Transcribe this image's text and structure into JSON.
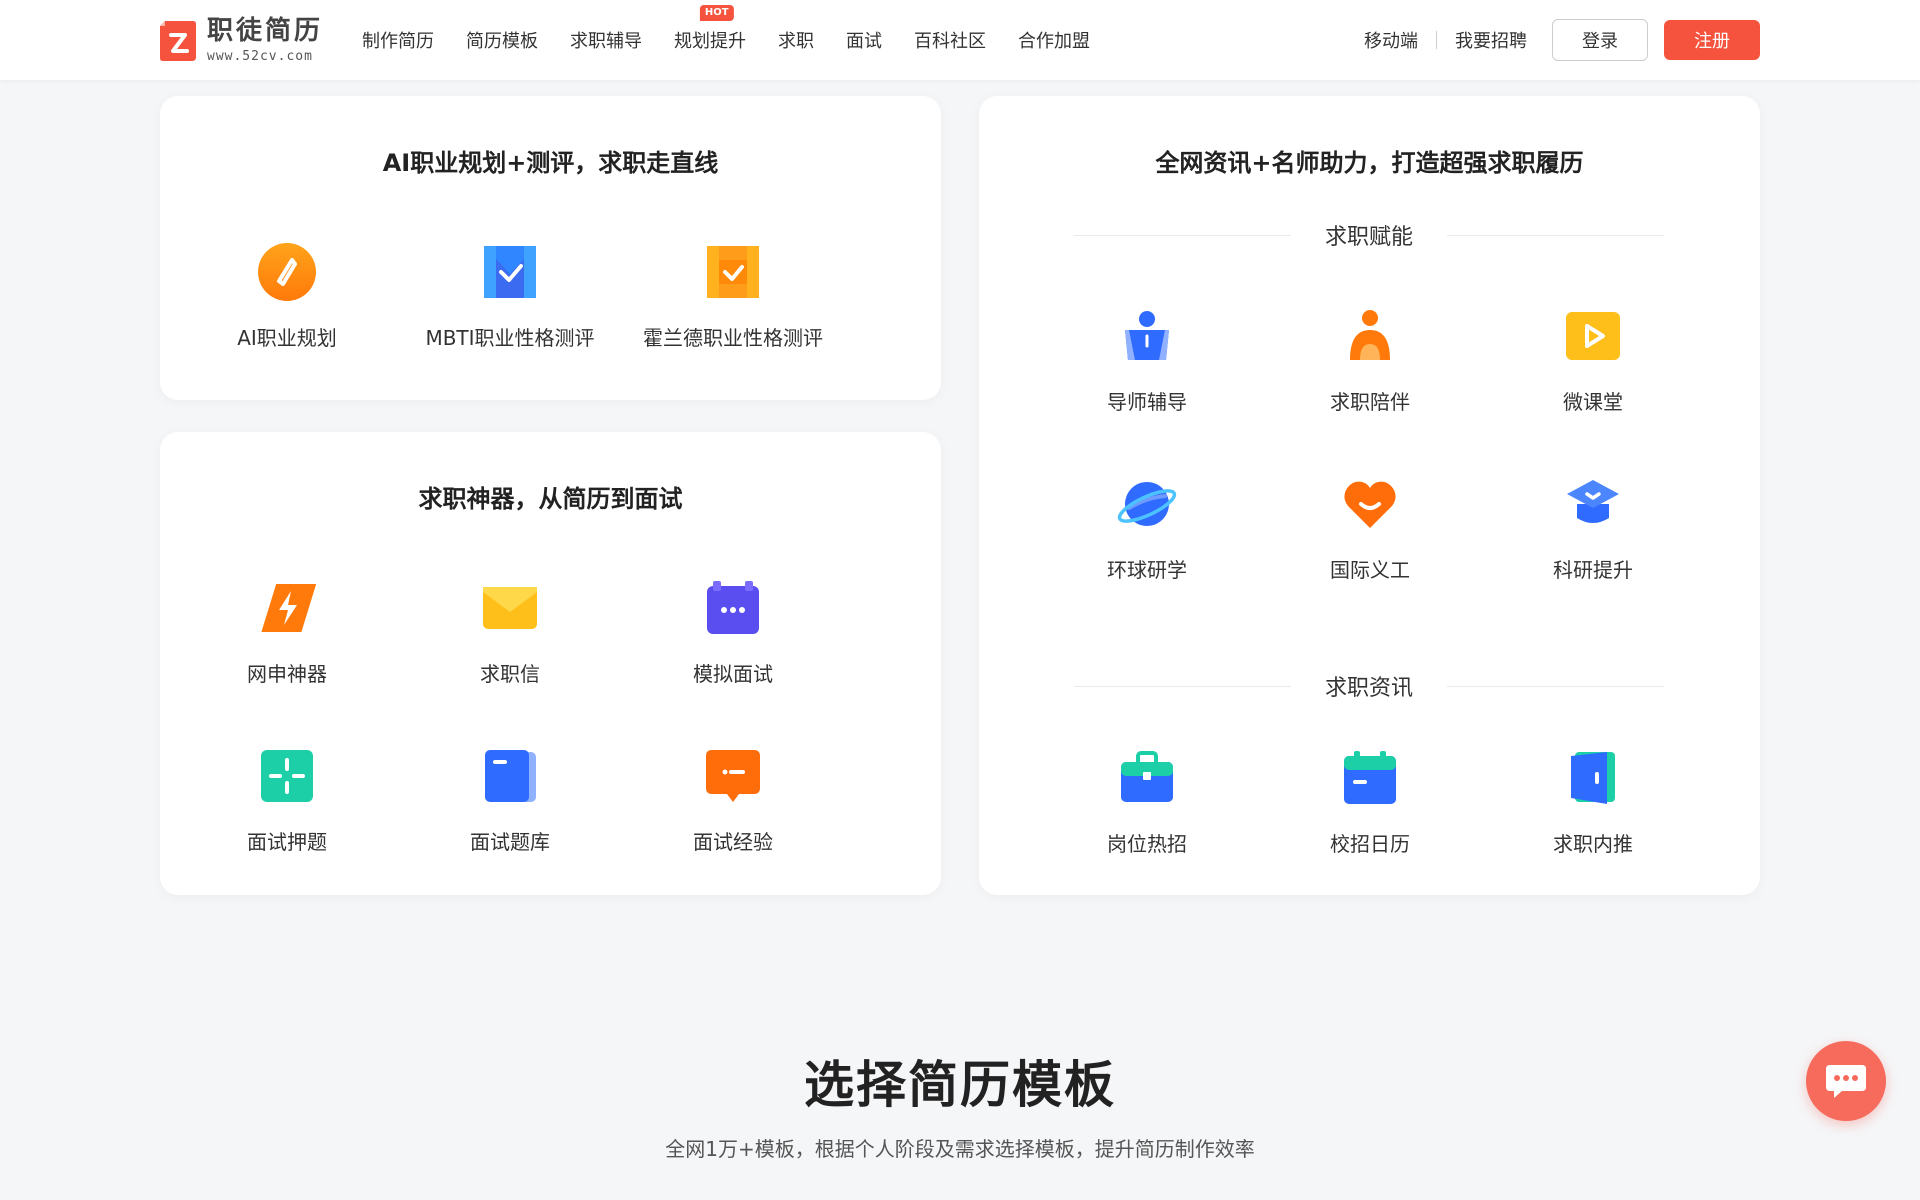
{
  "brand": {
    "name": "职徒简历",
    "url": "www.52cv.com",
    "accent": "#f5533d"
  },
  "nav": {
    "items": [
      {
        "label": "制作简历"
      },
      {
        "label": "简历模板"
      },
      {
        "label": "求职辅导"
      },
      {
        "label": "规划提升",
        "badge": "HOT"
      },
      {
        "label": "求职"
      },
      {
        "label": "面试"
      },
      {
        "label": "百科社区"
      },
      {
        "label": "合作加盟"
      }
    ]
  },
  "header_right": {
    "mobile": "移动端",
    "recruit": "我要招聘",
    "login": "登录",
    "register": "注册"
  },
  "card_ai": {
    "title": "AI职业规划+测评，求职走直线",
    "items": [
      {
        "label": "AI职业规划",
        "icon": "compass-icon"
      },
      {
        "label": "MBTI职业性格测评",
        "icon": "mbti-icon"
      },
      {
        "label": "霍兰德职业性格测评",
        "icon": "holland-icon"
      }
    ]
  },
  "card_tools": {
    "title": "求职神器，从简历到面试",
    "items": [
      {
        "label": "网申神器",
        "icon": "lightning-icon"
      },
      {
        "label": "求职信",
        "icon": "envelope-icon"
      },
      {
        "label": "模拟面试",
        "icon": "robot-icon"
      },
      {
        "label": "面试押题",
        "icon": "crosshair-icon"
      },
      {
        "label": "面试题库",
        "icon": "book-icon"
      },
      {
        "label": "面试经验",
        "icon": "message-icon"
      }
    ]
  },
  "card_info": {
    "title": "全网资讯+名师助力，打造超强求职履历",
    "section1": {
      "title": "求职赋能",
      "items": [
        {
          "label": "导师辅导",
          "icon": "mentor-icon"
        },
        {
          "label": "求职陪伴",
          "icon": "companion-icon"
        },
        {
          "label": "微课堂",
          "icon": "video-play-icon"
        },
        {
          "label": "环球研学",
          "icon": "planet-icon"
        },
        {
          "label": "国际义工",
          "icon": "heart-icon"
        },
        {
          "label": "科研提升",
          "icon": "graduation-cap-icon"
        }
      ]
    },
    "section2": {
      "title": "求职资讯",
      "items": [
        {
          "label": "岗位热招",
          "icon": "briefcase-icon"
        },
        {
          "label": "校招日历",
          "icon": "calendar-icon"
        },
        {
          "label": "求职内推",
          "icon": "door-icon"
        }
      ]
    }
  },
  "templates": {
    "title": "选择简历模板",
    "subtitle": "全网1万+模板，根据个人阶段及需求选择模板，提升简历制作效率"
  }
}
